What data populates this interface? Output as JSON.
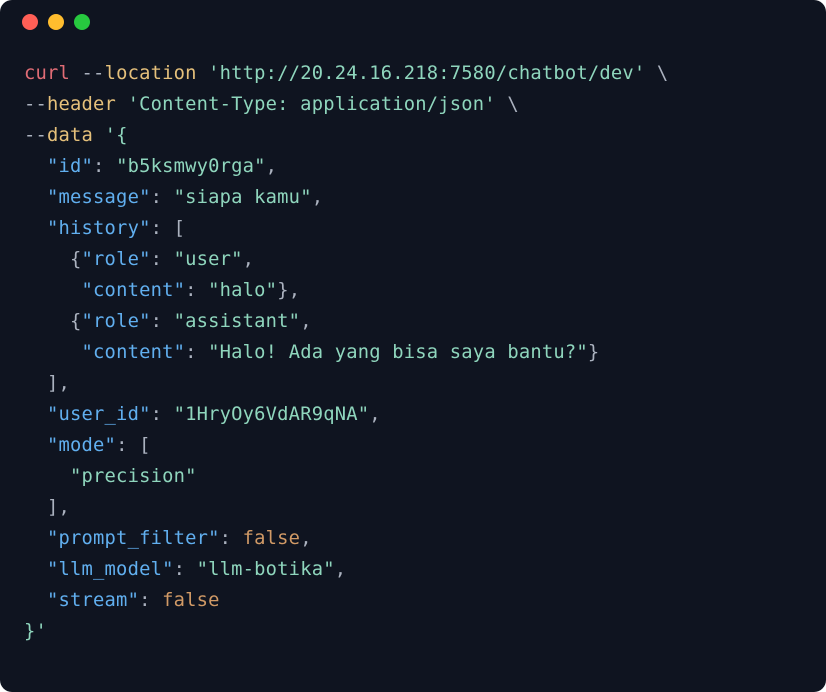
{
  "colors": {
    "background": "#0f1420",
    "red": "#ff5f56",
    "yellow": "#ffbd2e",
    "green": "#27c93f",
    "cmd": "#e06c75",
    "flag": "#e5c07b",
    "neutral": "#abb2bf",
    "string": "#8fd6bd",
    "key": "#61afef",
    "bool": "#d19a66"
  },
  "code": {
    "cmd": "curl",
    "dashdash1": "--",
    "flag_location": "location",
    "url": "'http://20.24.16.218:7580/chatbot/dev'",
    "backslash": " \\",
    "dashdash2": "--",
    "flag_header": "header",
    "header_value": "'Content-Type: application/json'",
    "dashdash3": "--",
    "flag_data": "data",
    "data_open": "'{",
    "k_id": "\"id\"",
    "v_id": "\"b5ksmwy0rga\"",
    "k_message": "\"message\"",
    "v_message": "\"siapa kamu\"",
    "k_history": "\"history\"",
    "k_role1": "\"role\"",
    "v_role1": "\"user\"",
    "k_content1": "\"content\"",
    "v_content1": "\"halo\"",
    "k_role2": "\"role\"",
    "v_role2": "\"assistant\"",
    "k_content2": "\"content\"",
    "v_content2": "\"Halo! Ada yang bisa saya bantu?\"",
    "k_user_id": "\"user_id\"",
    "v_user_id": "\"1HryOy6VdAR9qNA\"",
    "k_mode": "\"mode\"",
    "v_mode_item": "\"precision\"",
    "k_prompt_filter": "\"prompt_filter\"",
    "v_false1": "false",
    "k_llm_model": "\"llm_model\"",
    "v_llm_model": "\"llm-botika\"",
    "k_stream": "\"stream\"",
    "v_false2": "false",
    "data_close": "}'",
    "colon": ": ",
    "comma": ",",
    "lbracket": "[",
    "rbracket": "]",
    "lbrace": "{",
    "rbrace": "}",
    "sp": " "
  }
}
